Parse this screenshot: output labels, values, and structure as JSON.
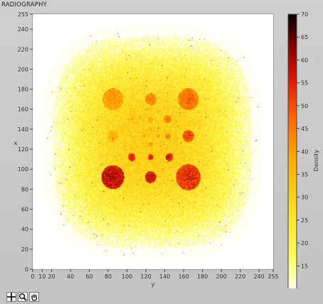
{
  "window": {
    "title": "RADIOGRAPHY"
  },
  "toolbar": {
    "tools": [
      {
        "icon": "crosshair-cursor-icon"
      },
      {
        "icon": "zoom-icon"
      },
      {
        "icon": "pan-hand-icon"
      }
    ]
  },
  "colors": {
    "plot_background": "#ffffff",
    "panel_background": "#c8c8c8",
    "scale": [
      "#ffffff",
      "#ffff33",
      "#ffc21a",
      "#ff8a00",
      "#e61a00",
      "#8c0000",
      "#000000"
    ]
  },
  "chart_data": {
    "type": "heatmap",
    "title": "RADIOGRAPHY",
    "xlabel": "y",
    "ylabel": "x",
    "xlim": [
      0,
      255
    ],
    "ylim": [
      0,
      255
    ],
    "x_ticks": [
      "0",
      "10",
      "20",
      "40",
      "60",
      "80",
      "100",
      "120",
      "140",
      "160",
      "180",
      "200",
      "220",
      "240",
      "255"
    ],
    "y_ticks": [
      "0",
      "20",
      "40",
      "60",
      "80",
      "100",
      "120",
      "140",
      "160",
      "180",
      "200",
      "220",
      "240",
      "255"
    ],
    "colorbar": {
      "label": "Density",
      "range": [
        9,
        70
      ],
      "ticks": [
        "9",
        "15",
        "20",
        "25",
        "30",
        "35",
        "40",
        "45",
        "50",
        "55",
        "60",
        "65",
        "70"
      ]
    },
    "background_field": {
      "center": [
        127,
        127
      ],
      "half_width": 108,
      "max_density": 31
    },
    "features": [
      {
        "name": "top-left large disk",
        "center": [
          85,
          170
        ],
        "radius": 11,
        "density": 42
      },
      {
        "name": "top-middle disk",
        "center": [
          125,
          170
        ],
        "radius": 6,
        "density": 45
      },
      {
        "name": "top-right large disk",
        "center": [
          165,
          170
        ],
        "radius": 11,
        "density": 47
      },
      {
        "name": "row 2 left",
        "center": [
          105,
          150
        ],
        "radius": 3.5,
        "density": 35
      },
      {
        "name": "row 2 middle",
        "center": [
          125,
          150
        ],
        "radius": 3,
        "density": 40
      },
      {
        "name": "row 2 right",
        "center": [
          143,
          150
        ],
        "radius": 4,
        "density": 45
      },
      {
        "name": "center cluster 1",
        "center": [
          125,
          140
        ],
        "radius": 2,
        "density": 38
      },
      {
        "name": "mid-left disk",
        "center": [
          85,
          133
        ],
        "radius": 6,
        "density": 38
      },
      {
        "name": "center cluster 2",
        "center": [
          108,
          132
        ],
        "radius": 3,
        "density": 34
      },
      {
        "name": "center cluster 3",
        "center": [
          118,
          133
        ],
        "radius": 2,
        "density": 38
      },
      {
        "name": "center cluster 4",
        "center": [
          133,
          133
        ],
        "radius": 2,
        "density": 40
      },
      {
        "name": "center cluster 5",
        "center": [
          143,
          133
        ],
        "radius": 3,
        "density": 45
      },
      {
        "name": "mid-right disk",
        "center": [
          165,
          133
        ],
        "radius": 6,
        "density": 52
      },
      {
        "name": "center cluster 6",
        "center": [
          125,
          125
        ],
        "radius": 2,
        "density": 40
      },
      {
        "name": "row 4 left",
        "center": [
          105,
          112
        ],
        "radius": 4,
        "density": 56
      },
      {
        "name": "row 4 middle",
        "center": [
          125,
          112
        ],
        "radius": 3,
        "density": 56
      },
      {
        "name": "row 4 right",
        "center": [
          145,
          112
        ],
        "radius": 4,
        "density": 56
      },
      {
        "name": "bottom-left large disk",
        "center": [
          85,
          92
        ],
        "radius": 12,
        "density": 60
      },
      {
        "name": "bottom-middle disk",
        "center": [
          125,
          92
        ],
        "radius": 6,
        "density": 58
      },
      {
        "name": "bottom-right large disk",
        "center": [
          165,
          92
        ],
        "radius": 13,
        "density": 55
      }
    ]
  }
}
